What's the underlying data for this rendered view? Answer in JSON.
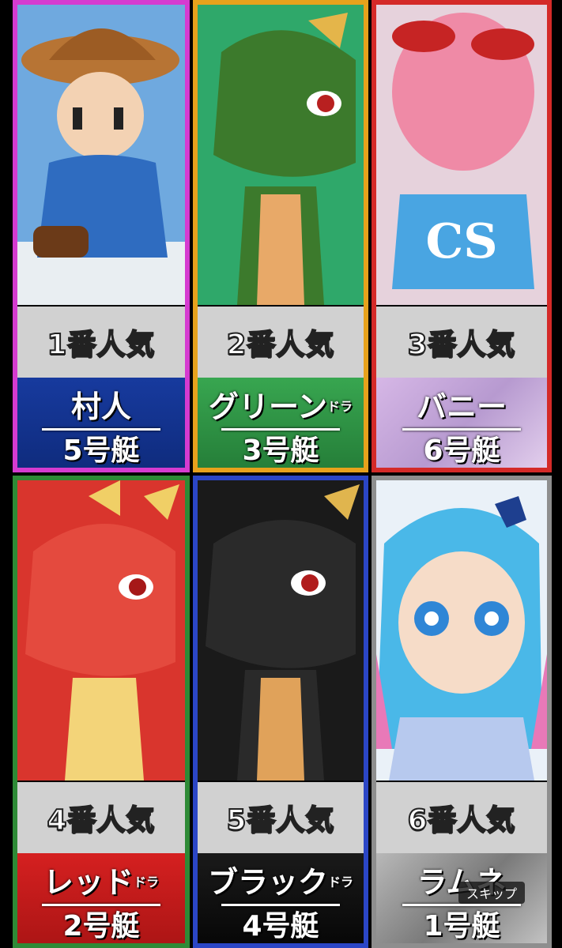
{
  "cards": [
    {
      "rank": "1番人気",
      "name": "村人",
      "suffix": "",
      "boat": "5号艇",
      "colors": {
        "border": "#d53bd0",
        "name_bg": "#173a9e",
        "art_bg": "#6fa9df"
      }
    },
    {
      "rank": "2番人気",
      "name": "グリーン",
      "suffix": "ドラ",
      "boat": "3号艇",
      "colors": {
        "border": "#e7a21c",
        "name_bg": "#2f9a48",
        "art_bg": "#2fa86a"
      }
    },
    {
      "rank": "3番人気",
      "name": "バニー",
      "suffix": "",
      "boat": "6号艇",
      "colors": {
        "border": "#d42a28",
        "name_bg": "#c7a6d6",
        "art_bg": "#e6d2dc"
      }
    },
    {
      "rank": "4番人気",
      "name": "レッド",
      "suffix": "ドラ",
      "boat": "2号艇",
      "colors": {
        "border": "#2e8a36",
        "name_bg": "#cf1d1d",
        "art_bg": "#d9352d"
      }
    },
    {
      "rank": "5番人気",
      "name": "ブラック",
      "suffix": "ドラ",
      "boat": "4号艇",
      "colors": {
        "border": "#2b46c6",
        "name_bg": "#111111",
        "art_bg": "#1a1a1a"
      }
    },
    {
      "rank": "6番人気",
      "name": "ラムネ",
      "suffix": "",
      "boat": "1号艇",
      "colors": {
        "border": "#8e8e8e",
        "name_bg": "#8a8a8a",
        "art_bg": "#eaf1f8"
      }
    }
  ],
  "skip_label": "スキップ"
}
